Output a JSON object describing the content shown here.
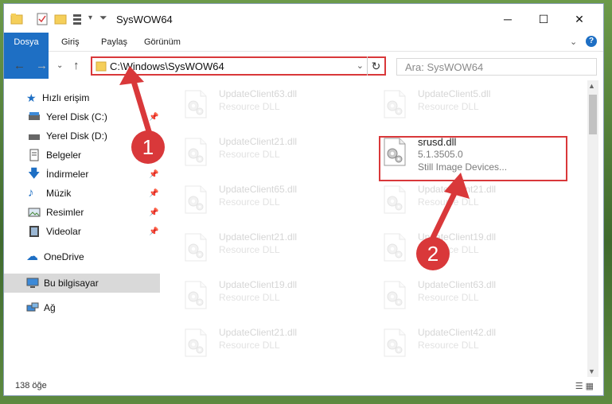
{
  "window": {
    "title": "SysWOW64"
  },
  "ribbon": {
    "tabs": [
      "Dosya",
      "Giriş",
      "Paylaş",
      "Görünüm"
    ]
  },
  "nav": {
    "address": "C:\\Windows\\SysWOW64",
    "search_placeholder": "Ara: SysWOW64"
  },
  "sidebar": {
    "items": [
      {
        "label": "Hızlı erişim"
      },
      {
        "label": "Yerel Disk (C:)"
      },
      {
        "label": "Yerel Disk (D:)"
      },
      {
        "label": "Belgeler"
      },
      {
        "label": "İndirmeler"
      },
      {
        "label": "Müzik"
      },
      {
        "label": "Resimler"
      },
      {
        "label": "Videolar"
      },
      {
        "label": "OneDrive"
      },
      {
        "label": "Bu bilgisayar"
      },
      {
        "label": "Ağ"
      }
    ]
  },
  "files": [
    {
      "name": "UpdateClient63.dll",
      "desc": "Resource DLL",
      "faded": true
    },
    {
      "name": "UpdateClient5.dll",
      "desc": "Resource DLL",
      "faded": true
    },
    {
      "name": "UpdateClient21.dll",
      "desc": "Resource DLL",
      "faded": true
    },
    {
      "name": "srusd.dll",
      "desc": "5.1.3505.0",
      "extra": "Still Image Devices...",
      "faded": false
    },
    {
      "name": "UpdateClient65.dll",
      "desc": "Resource DLL",
      "faded": true
    },
    {
      "name": "UpdateClient21.dll",
      "desc": "Resource DLL",
      "faded": true
    },
    {
      "name": "UpdateClient21.dll",
      "desc": "Resource DLL",
      "faded": true
    },
    {
      "name": "UpdateClient19.dll",
      "desc": "Resource DLL",
      "faded": true
    },
    {
      "name": "UpdateClient19.dll",
      "desc": "Resource DLL",
      "faded": true
    },
    {
      "name": "UpdateClient63.dll",
      "desc": "Resource DLL",
      "faded": true
    },
    {
      "name": "UpdateClient21.dll",
      "desc": "Resource DLL",
      "faded": true
    },
    {
      "name": "UpdateClient42.dll",
      "desc": "Resource DLL",
      "faded": true
    }
  ],
  "annotations": [
    "1",
    "2"
  ],
  "status": {
    "count": "138 öğe"
  }
}
